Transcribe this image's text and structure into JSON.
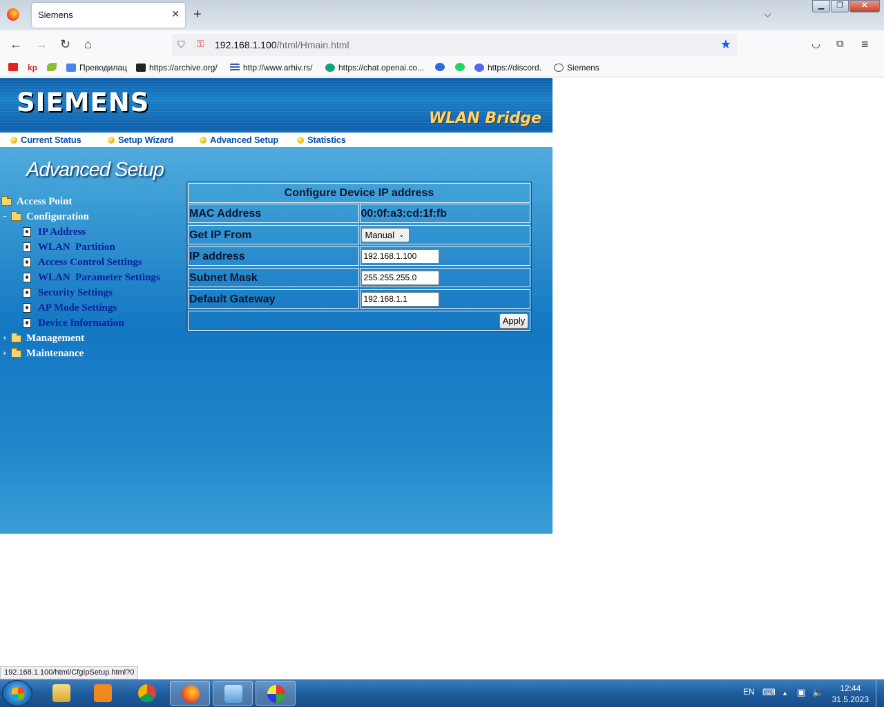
{
  "browser": {
    "tab_title": "Siemens",
    "tab_close": "✕",
    "new_tab": "+",
    "url_host": "192.168.1.100",
    "url_path": "/html/Hmain.html",
    "bookmarks": [
      {
        "label": "",
        "color": "#e62117"
      },
      {
        "label": "kp",
        "color": "#d9261c"
      },
      {
        "label": "",
        "color": "#8bbf3a"
      },
      {
        "label": "Преводилац",
        "color": "#4a86e8"
      },
      {
        "label": "https://archive.org/",
        "color": "#222222"
      },
      {
        "label": "http://www.arhiv.rs/",
        "color": "#3a5aa8"
      },
      {
        "label": "https://chat.openai.co...",
        "color": "#10a37f"
      },
      {
        "label": "",
        "color": "#2b6fd6"
      },
      {
        "label": "",
        "color": "#25d366"
      },
      {
        "label": "https://discord.",
        "color": "#5865f2"
      },
      {
        "label": "Siemens",
        "color": "#555555"
      }
    ],
    "status_url": "192.168.1.100/html/CfgIpSetup.html?0"
  },
  "device": {
    "brand": "SIEMENS",
    "product": "WLAN Bridge",
    "menu": [
      "Current Status",
      "Setup Wizard",
      "Advanced Setup",
      "Statistics"
    ],
    "section_title": "Advanced Setup",
    "tree": {
      "root": "Access Point",
      "configuration": "Configuration",
      "pages": [
        "IP Address",
        "WLAN  Partition",
        "Access Control Settings",
        "WLAN  Parameter Settings",
        "Security Settings",
        "AP Mode Settings",
        "Device Information"
      ],
      "management": "Management",
      "maintenance": "Maintenance"
    }
  },
  "form": {
    "title": "Configure Device IP address",
    "mac_label": "MAC Address",
    "mac_value": "00:0f:a3:cd:1f:fb",
    "getip_label": "Get IP From",
    "getip_value": "Manual",
    "ip_label": "IP address",
    "ip_value": "192.168.1.100",
    "mask_label": "Subnet Mask",
    "mask_value": "255.255.255.0",
    "gw_label": "Default Gateway",
    "gw_value": "192.168.1.1",
    "apply_label": "Apply"
  },
  "taskbar": {
    "language": "EN",
    "time": "12:44",
    "date": "31.5.2023"
  }
}
